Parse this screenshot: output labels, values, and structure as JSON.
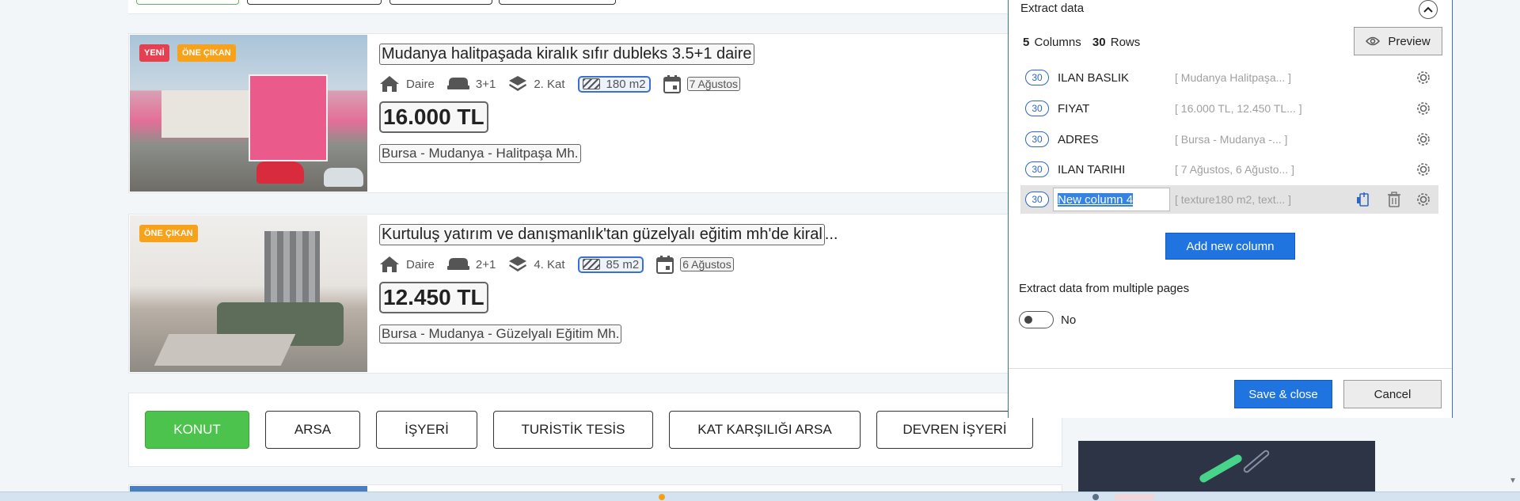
{
  "listings": [
    {
      "badges": [
        "YENİ",
        "ÖNE ÇIKAN"
      ],
      "title": "Mudanya halitpaşada kiralık sıfır dubleks 3.5+1 daire",
      "type": "Daire",
      "rooms": "3+1",
      "floor": "2. Kat",
      "area": "180 m2",
      "date": "7 Ağustos",
      "price": "16.000 TL",
      "address": "Bursa - Mudanya - Halitpaşa Mh."
    },
    {
      "badges": [
        "ÖNE ÇIKAN"
      ],
      "title": "Kurtuluş yatırım ve danışmanlık'tan güzelyalı eğitim mh'de kiral",
      "title_ellipsis": "...",
      "type": "Daire",
      "rooms": "2+1",
      "floor": "4. Kat",
      "area": "85 m2",
      "date": "6 Ağustos",
      "price": "12.450 TL",
      "address": "Bursa - Mudanya - Güzelyalı Eğitim Mh."
    }
  ],
  "categories": [
    "KONUT",
    "ARSA",
    "İŞYERİ",
    "TURİSTİK TESİS",
    "KAT KARŞILIĞI ARSA",
    "DEVREN İŞYERİ"
  ],
  "categories_active": "KONUT",
  "panel": {
    "title": "Extract data",
    "columns_count": "5",
    "columns_label": "Columns",
    "rows_count": "30",
    "rows_label": "Rows",
    "preview_label": "Preview",
    "columns": [
      {
        "count": "30",
        "name": "ILAN BASLIK",
        "sample": "[ Mudanya Halitpaşa...  ]"
      },
      {
        "count": "30",
        "name": "FIYAT",
        "sample": "[ 16.000 TL, 12.450 TL...  ]"
      },
      {
        "count": "30",
        "name": "ADRES",
        "sample": "[ Bursa - Mudanya -...  ]"
      },
      {
        "count": "30",
        "name": "ILAN TARIHI",
        "sample": "[ 7 Ağustos, 6 Ağusto...  ]"
      },
      {
        "count": "30",
        "name": "New column 4",
        "sample": "[ texture180 m2, text...  ]"
      }
    ],
    "add_column_label": "Add new column",
    "multi_pages_label": "Extract data from multiple pages",
    "multi_pages_value": "No",
    "save_label": "Save & close",
    "cancel_label": "Cancel"
  },
  "colors": {
    "accent_blue": "#1f74e0",
    "active_green": "#4cc34c",
    "badge_red": "#e4404f",
    "badge_orange": "#f7a21b"
  }
}
